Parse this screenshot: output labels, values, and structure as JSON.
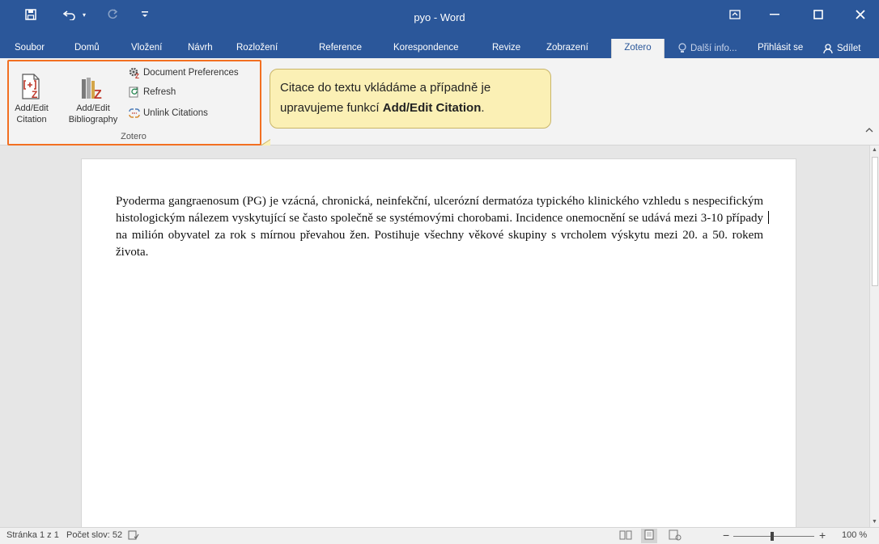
{
  "window": {
    "title": "pyo - Word"
  },
  "quick_access": {
    "save_icon": "save-icon",
    "undo_icon": "undo-icon",
    "redo_icon": "redo-icon",
    "customize_icon": "customize-qat-icon"
  },
  "tabs": [
    {
      "label": "Soubor"
    },
    {
      "label": "Domů"
    },
    {
      "label": "Vložení"
    },
    {
      "label": "Návrh"
    },
    {
      "label": "Rozložení"
    },
    {
      "label": "Reference"
    },
    {
      "label": "Korespondence"
    },
    {
      "label": "Revize"
    },
    {
      "label": "Zobrazení"
    },
    {
      "label": "Zotero"
    }
  ],
  "active_tab": "Zotero",
  "tell_me": "Další info...",
  "sign_in": "Přihlásit se",
  "share": "Sdílet",
  "ribbon": {
    "group_label": "Zotero",
    "add_edit_citation": [
      "Add/Edit",
      "Citation"
    ],
    "add_edit_bibliography": [
      "Add/Edit",
      "Bibliography"
    ],
    "document_preferences": "Document Preferences",
    "refresh": "Refresh",
    "unlink_citations": "Unlink Citations"
  },
  "callout": {
    "text_before": "Citace do textu vkládáme a případně je upravujeme funkcí ",
    "text_bold": "Add/Edit Citation",
    "text_after": "."
  },
  "document": {
    "paragraph": "Pyoderma gangraenosum (PG) je vzácná, chronická, neinfekční, ulcerózní dermatóza typického klinického vzhledu s nespecifickým histologickým nálezem vyskytující se často společně se systémovými chorobami. Incidence onemocnění se udává mezi 3-10 případy na milión obyvatel za rok s mírnou převahou žen. Postihuje všechny věkové skupiny s vrcholem výskytu mezi 20. a 50. rokem života."
  },
  "status": {
    "page": "Stránka 1 z 1",
    "words": "Počet slov: 52",
    "zoom": "100 %"
  },
  "colors": {
    "word_blue": "#2b579a",
    "highlight_orange": "#f26f21",
    "callout_fill": "#fbf0b5"
  }
}
